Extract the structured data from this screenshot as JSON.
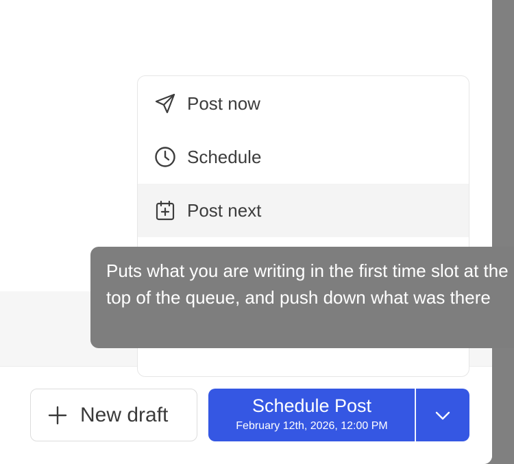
{
  "menu": {
    "items": [
      {
        "label": "Post now",
        "icon": "send-icon"
      },
      {
        "label": "Schedule",
        "icon": "clock-icon"
      },
      {
        "label": "Post next",
        "icon": "calendar-plus-icon"
      }
    ]
  },
  "tooltip": {
    "text": "Puts what you are writing in the first time slot at the top of the queue, and push down what was there"
  },
  "footer": {
    "new_draft_label": "New draft",
    "schedule_label": "Schedule Post",
    "schedule_datetime": "February 12th, 2026, 12:00 PM"
  },
  "colors": {
    "accent": "#3557e3",
    "tooltip_bg": "#7e7e7e",
    "backdrop": "#808080"
  }
}
